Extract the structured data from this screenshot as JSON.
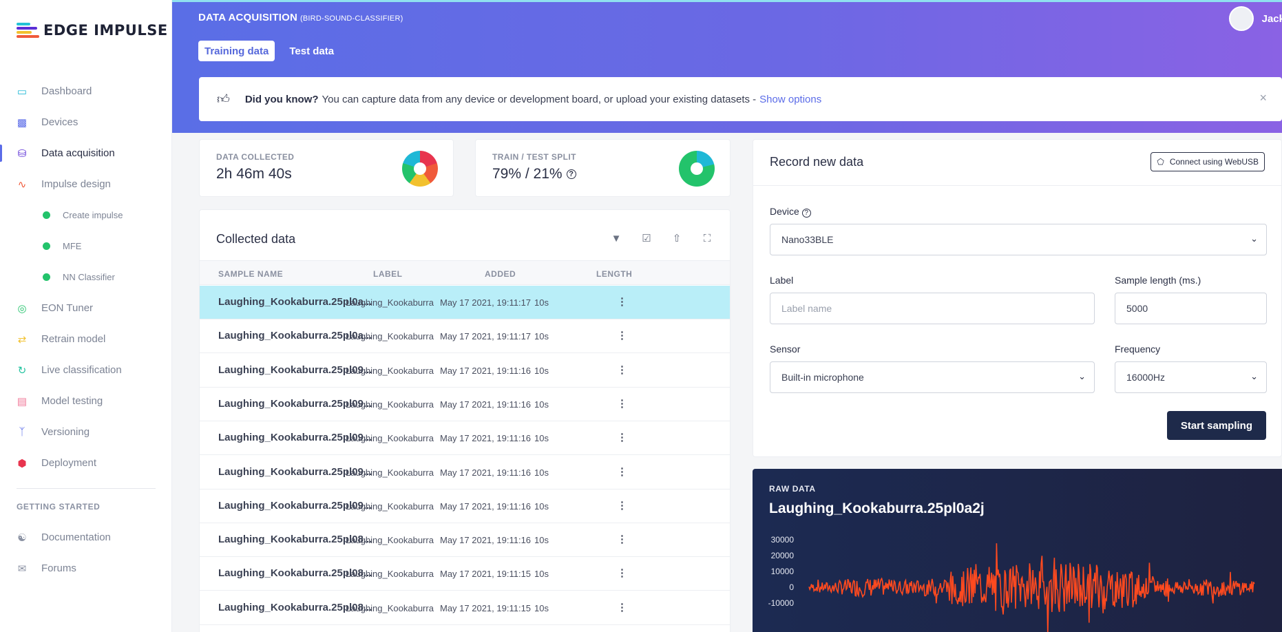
{
  "app": {
    "logo_text": "EDGE IMPULSE",
    "user_name": "Jack"
  },
  "sidebar": {
    "items": [
      {
        "label": "Dashboard",
        "icon": "monitor-icon",
        "color": "#1fb8d6"
      },
      {
        "label": "Devices",
        "icon": "chip-icon",
        "color": "#5b6ce8"
      },
      {
        "label": "Data acquisition",
        "icon": "database-icon",
        "color": "#5b2fd6",
        "active": true
      },
      {
        "label": "Impulse design",
        "icon": "pulse-icon",
        "color": "#f05a3a"
      }
    ],
    "sub_items": [
      {
        "label": "Create impulse",
        "status_color": "#23c36b"
      },
      {
        "label": "MFE",
        "status_color": "#23c36b"
      },
      {
        "label": "NN Classifier",
        "status_color": "#23c36b"
      }
    ],
    "items2": [
      {
        "label": "EON Tuner",
        "icon": "target-icon",
        "color": "#23c36b"
      },
      {
        "label": "Retrain model",
        "icon": "shuffle-icon",
        "color": "#f2c12e"
      },
      {
        "label": "Live classification",
        "icon": "live-icon",
        "color": "#23c3a0"
      },
      {
        "label": "Model testing",
        "icon": "clipboard-icon",
        "color": "#f07a9a"
      },
      {
        "label": "Versioning",
        "icon": "branch-icon",
        "color": "#5b6ce8"
      },
      {
        "label": "Deployment",
        "icon": "box-icon",
        "color": "#e8344e"
      }
    ],
    "section_heading": "GETTING STARTED",
    "getting_started": [
      {
        "label": "Documentation",
        "icon": "book-icon"
      },
      {
        "label": "Forums",
        "icon": "chat-icon"
      }
    ]
  },
  "header": {
    "title": "DATA ACQUISITION",
    "project": "(BIRD-SOUND-CLASSIFIER)",
    "tabs": [
      {
        "label": "Training data",
        "active": true
      },
      {
        "label": "Test data",
        "active": false
      }
    ]
  },
  "tip": {
    "bold": "Did you know?",
    "text": "You can capture data from any device or development board, or upload your existing datasets -",
    "link": "Show options",
    "close": "×"
  },
  "stats": {
    "collected": {
      "label": "DATA COLLECTED",
      "value": "2h 46m 40s"
    },
    "split": {
      "label": "TRAIN / TEST SPLIT",
      "value": "79% / 21%",
      "help": "?"
    }
  },
  "collected": {
    "title": "Collected data",
    "columns": [
      "SAMPLE NAME",
      "LABEL",
      "ADDED",
      "LENGTH"
    ],
    "rows": [
      {
        "name": "Laughing_Kookaburra.25pl0a...",
        "label": "Laughing_Kookaburra",
        "added": "May 17 2021, 19:11:17",
        "length": "10s",
        "selected": true
      },
      {
        "name": "Laughing_Kookaburra.25pl0a...",
        "label": "Laughing_Kookaburra",
        "added": "May 17 2021, 19:11:17",
        "length": "10s"
      },
      {
        "name": "Laughing_Kookaburra.25pl09...",
        "label": "Laughing_Kookaburra",
        "added": "May 17 2021, 19:11:16",
        "length": "10s"
      },
      {
        "name": "Laughing_Kookaburra.25pl09...",
        "label": "Laughing_Kookaburra",
        "added": "May 17 2021, 19:11:16",
        "length": "10s"
      },
      {
        "name": "Laughing_Kookaburra.25pl09...",
        "label": "Laughing_Kookaburra",
        "added": "May 17 2021, 19:11:16",
        "length": "10s"
      },
      {
        "name": "Laughing_Kookaburra.25pl09...",
        "label": "Laughing_Kookaburra",
        "added": "May 17 2021, 19:11:16",
        "length": "10s"
      },
      {
        "name": "Laughing_Kookaburra.25pl09...",
        "label": "Laughing_Kookaburra",
        "added": "May 17 2021, 19:11:16",
        "length": "10s"
      },
      {
        "name": "Laughing_Kookaburra.25pl08...",
        "label": "Laughing_Kookaburra",
        "added": "May 17 2021, 19:11:16",
        "length": "10s"
      },
      {
        "name": "Laughing_Kookaburra.25pl08...",
        "label": "Laughing_Kookaburra",
        "added": "May 17 2021, 19:11:15",
        "length": "10s"
      },
      {
        "name": "Laughing_Kookaburra.25pl08...",
        "label": "Laughing_Kookaburra",
        "added": "May 17 2021, 19:11:15",
        "length": "10s"
      }
    ]
  },
  "record": {
    "title": "Record new data",
    "webusb_label": "Connect using WebUSB",
    "device_label": "Device",
    "device_value": "Nano33BLE",
    "label_label": "Label",
    "label_placeholder": "Label name",
    "length_label": "Sample length (ms.)",
    "length_value": "5000",
    "sensor_label": "Sensor",
    "sensor_value": "Built-in microphone",
    "frequency_label": "Frequency",
    "frequency_value": "16000Hz",
    "start_label": "Start sampling"
  },
  "raw": {
    "label": "RAW DATA",
    "sample_name": "Laughing_Kookaburra.25pl0a2j",
    "y_ticks": [
      "30000",
      "20000",
      "10000",
      "0",
      "-10000"
    ],
    "series_color": "#ff4a1f"
  }
}
